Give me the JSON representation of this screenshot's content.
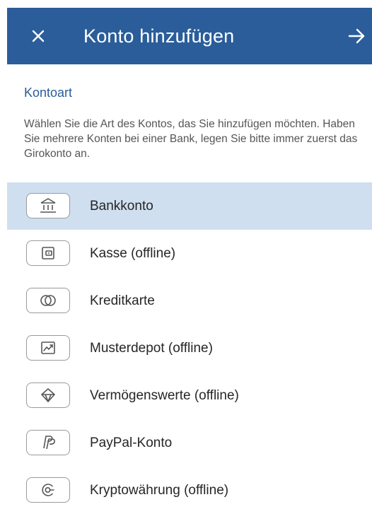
{
  "header": {
    "title": "Konto hinzufügen",
    "close_icon": "close-icon",
    "next_icon": "arrow-right-icon",
    "background_color": "#2a5d9a"
  },
  "section": {
    "title": "Kontoart",
    "description": "Wählen Sie die Art des Kontos, das Sie hinzufügen möchten. Haben Sie mehrere Konten bei einer Bank, legen Sie bitte immer zuerst das Girokonto an."
  },
  "accounts": [
    {
      "label": "Bankkonto",
      "icon": "bank-icon",
      "selected": true
    },
    {
      "label": "Kasse (offline)",
      "icon": "wallet-icon",
      "selected": false
    },
    {
      "label": "Kreditkarte",
      "icon": "credit-card-icon",
      "selected": false
    },
    {
      "label": "Musterdepot (offline)",
      "icon": "chart-icon",
      "selected": false
    },
    {
      "label": "Vermögenswerte (offline)",
      "icon": "diamond-icon",
      "selected": false
    },
    {
      "label": "PayPal-Konto",
      "icon": "paypal-icon",
      "selected": false
    },
    {
      "label": "Kryptowährung (offline)",
      "icon": "crypto-icon",
      "selected": false
    }
  ],
  "colors": {
    "accent": "#2a5d9a",
    "selected_row": "#cfdff0",
    "icon_stroke": "#555555"
  }
}
